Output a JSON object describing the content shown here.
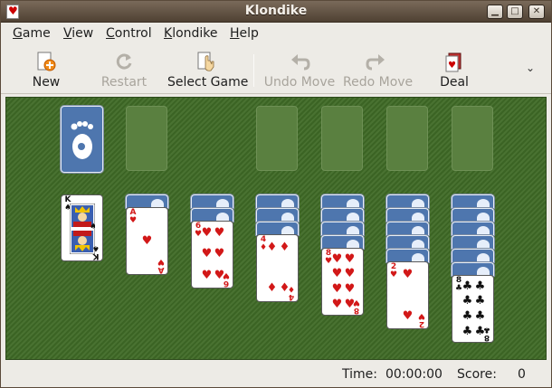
{
  "window": {
    "title": "Klondike"
  },
  "menu": {
    "items": [
      {
        "label": "Game",
        "underline": "G"
      },
      {
        "label": "View",
        "underline": "V"
      },
      {
        "label": "Control",
        "underline": "C"
      },
      {
        "label": "Klondike",
        "underline": "K"
      },
      {
        "label": "Help",
        "underline": "H"
      }
    ]
  },
  "toolbar": {
    "new_label": "New",
    "restart_label": "Restart",
    "select_game_label": "Select Game",
    "undo_label": "Undo Move",
    "redo_label": "Redo Move",
    "deal_label": "Deal"
  },
  "board": {
    "background": "#3f6a26",
    "tableau": [
      {
        "face_down": 0,
        "top_card": {
          "rank": "K",
          "suit": "♠",
          "color": "black"
        }
      },
      {
        "face_down": 1,
        "top_card": {
          "rank": "A",
          "suit": "♥",
          "color": "red"
        }
      },
      {
        "face_down": 2,
        "top_card": {
          "rank": "6",
          "suit": "♥",
          "color": "red"
        }
      },
      {
        "face_down": 3,
        "top_card": {
          "rank": "4",
          "suit": "♦",
          "color": "red"
        }
      },
      {
        "face_down": 4,
        "top_card": {
          "rank": "8",
          "suit": "♥",
          "color": "red"
        }
      },
      {
        "face_down": 5,
        "top_card": {
          "rank": "2",
          "suit": "♥",
          "color": "red"
        }
      },
      {
        "face_down": 6,
        "top_card": {
          "rank": "8",
          "suit": "♣",
          "color": "black"
        }
      }
    ]
  },
  "status": {
    "time_label": "Time:",
    "time_value": "00:00:00",
    "score_label": "Score:",
    "score_value": "0"
  }
}
